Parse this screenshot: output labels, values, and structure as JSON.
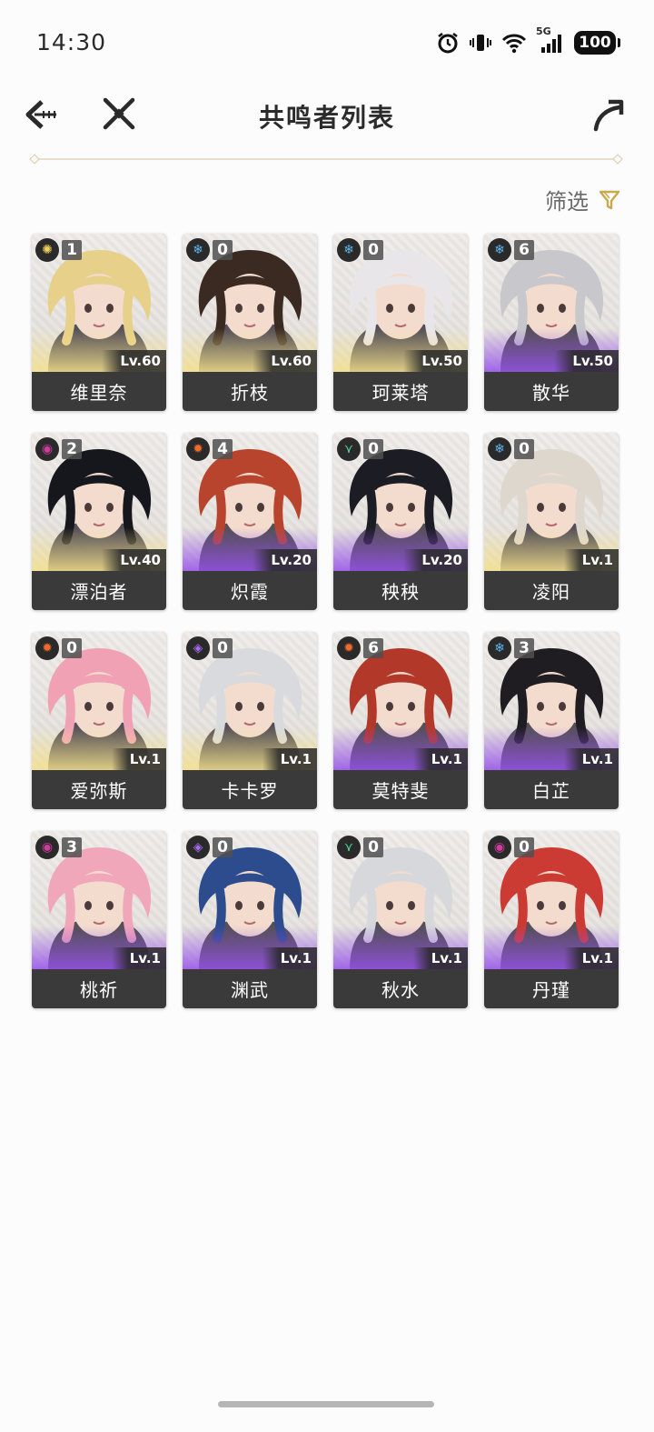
{
  "status_bar": {
    "time": "14:30",
    "network": "5G",
    "battery": "100"
  },
  "header": {
    "title": "共鸣者列表"
  },
  "filter": {
    "label": "筛选"
  },
  "characters": [
    {
      "name": "维里奈",
      "rank": "1",
      "level": "Lv.60",
      "element": "spectro-icon",
      "glow": "gold"
    },
    {
      "name": "折枝",
      "rank": "0",
      "level": "Lv.60",
      "element": "glacio-icon",
      "glow": "gold"
    },
    {
      "name": "珂莱塔",
      "rank": "0",
      "level": "Lv.50",
      "element": "glacio-icon",
      "glow": "gold"
    },
    {
      "name": "散华",
      "rank": "6",
      "level": "Lv.50",
      "element": "glacio-icon",
      "glow": "purple"
    },
    {
      "name": "漂泊者",
      "rank": "2",
      "level": "Lv.40",
      "element": "havoc-icon",
      "glow": "gold"
    },
    {
      "name": "炽霞",
      "rank": "4",
      "level": "Lv.20",
      "element": "fusion-icon",
      "glow": "purple"
    },
    {
      "name": "秧秧",
      "rank": "0",
      "level": "Lv.20",
      "element": "aero-icon",
      "glow": "purple"
    },
    {
      "name": "凌阳",
      "rank": "0",
      "level": "Lv.1",
      "element": "glacio-icon",
      "glow": "gold"
    },
    {
      "name": "爱弥斯",
      "rank": "0",
      "level": "Lv.1",
      "element": "fusion-icon",
      "glow": "gold"
    },
    {
      "name": "卡卡罗",
      "rank": "0",
      "level": "Lv.1",
      "element": "electro-icon",
      "glow": "gold"
    },
    {
      "name": "莫特斐",
      "rank": "6",
      "level": "Lv.1",
      "element": "fusion-icon",
      "glow": "purple"
    },
    {
      "name": "白芷",
      "rank": "3",
      "level": "Lv.1",
      "element": "glacio-icon",
      "glow": "purple"
    },
    {
      "name": "桃祈",
      "rank": "3",
      "level": "Lv.1",
      "element": "havoc-icon",
      "glow": "purple"
    },
    {
      "name": "渊武",
      "rank": "0",
      "level": "Lv.1",
      "element": "electro-icon",
      "glow": "purple"
    },
    {
      "name": "秋水",
      "rank": "0",
      "level": "Lv.1",
      "element": "aero-icon",
      "glow": "purple"
    },
    {
      "name": "丹瑾",
      "rank": "0",
      "level": "Lv.1",
      "element": "havoc-icon",
      "glow": "purple"
    }
  ],
  "colors": {
    "accent": "#c9a94e",
    "spectro": "#f2d35a",
    "glacio": "#5fb4ee",
    "havoc": "#d23aa0",
    "fusion": "#f06a2a",
    "aero": "#4fcf9a",
    "electro": "#a56af0",
    "hair": [
      "#e6d08a",
      "#3b2a22",
      "#e9e6ea",
      "#c8c8cc",
      "#15171d",
      "#b8442e",
      "#1c1c24",
      "#ddd7cd",
      "#f0a2b4",
      "#d8dadd",
      "#b2382a",
      "#1f1c22",
      "#f0a7b9",
      "#2d4c8e",
      "#d7d8db",
      "#cc3a34"
    ]
  }
}
